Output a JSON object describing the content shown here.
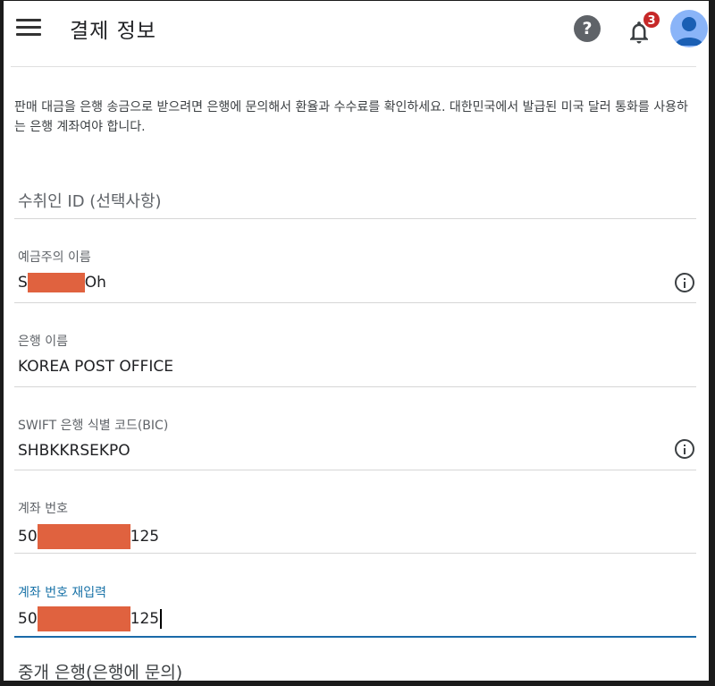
{
  "header": {
    "title": "결제 정보",
    "notification_count": "3"
  },
  "info_text": "판매 대금을 은행 송금으로 받으려면 은행에 문의해서 환율과 수수료를 확인하세요. 대한민국에서 발급된 미국 달러 통화를 사용하는 은행 계좌여야 합니다.",
  "fields": {
    "recipient_id": {
      "placeholder": "수취인 ID (선택사항)"
    },
    "account_holder": {
      "label": "예금주의 이름",
      "prefix": "S",
      "suffix": "Oh"
    },
    "bank_name": {
      "label": "은행 이름",
      "value": "KOREA POST OFFICE"
    },
    "swift": {
      "label": "SWIFT 은행 식별 코드(BIC)",
      "value": "SHBKKRSEKPO"
    },
    "account_number": {
      "label": "계좌 번호",
      "prefix": "50",
      "suffix": "125"
    },
    "account_number_confirm": {
      "label": "계좌 번호 재입력",
      "prefix": "50",
      "suffix": "125"
    }
  },
  "next_section": "중개 은행(은행에 문의)",
  "colors": {
    "accent": "#1a73a8",
    "redaction": "#e0623f",
    "badge": "#c62828"
  }
}
